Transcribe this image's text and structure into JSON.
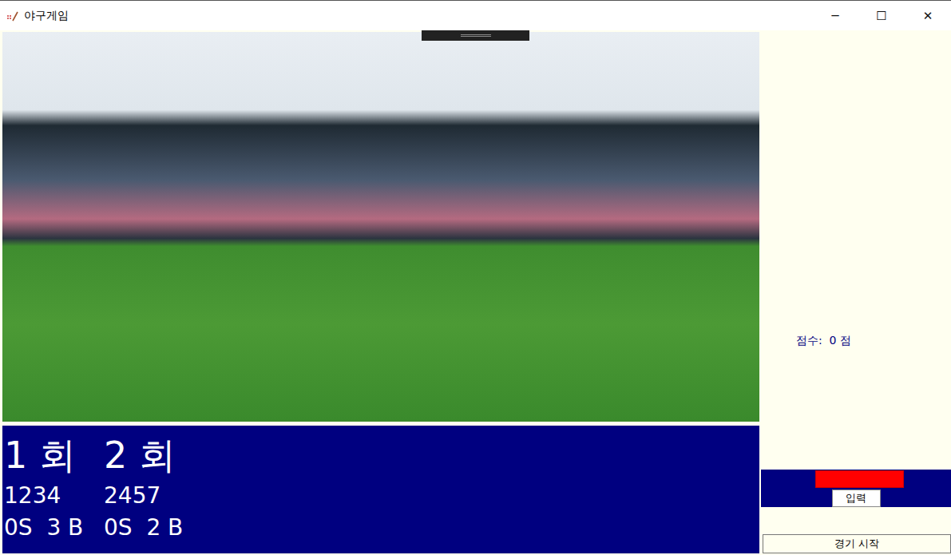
{
  "window": {
    "title": "야구게임",
    "controls": [
      "─",
      "☐",
      "✕"
    ]
  },
  "innings": [
    {
      "label": "1 회",
      "guess": "1234",
      "result": "0S  3 B"
    },
    {
      "label": "2 회",
      "guess": "2457",
      "result": "0S  2 B"
    }
  ],
  "score": {
    "text": "점수:  0 점"
  },
  "input": {
    "value": ""
  },
  "buttons": {
    "submit": "입력",
    "start": "경기 시작"
  }
}
